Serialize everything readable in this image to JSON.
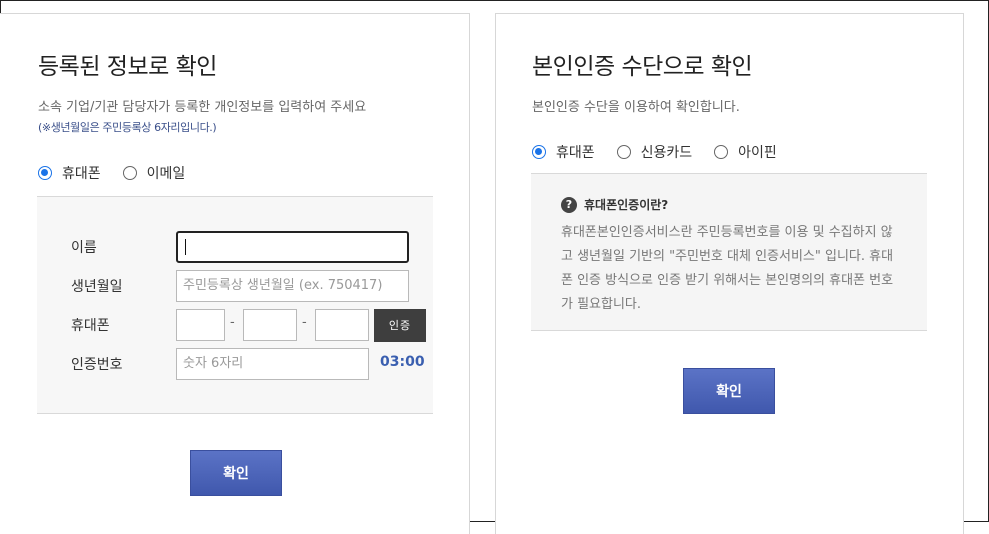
{
  "left": {
    "title": "등록된 정보로 확인",
    "desc": "소속 기업/기관 담당자가 등록한 개인정보를 입력하여 주세요",
    "note": "(※생년월일은 주민등록상 6자리입니다.)",
    "radios": [
      {
        "label": "휴대폰",
        "checked": true
      },
      {
        "label": "이메일",
        "checked": false
      }
    ],
    "form": {
      "name_label": "이름",
      "birth_label": "생년월일",
      "birth_placeholder": "주민등록상 생년월일 (ex. 750417)",
      "phone_label": "휴대폰",
      "phone_dash": "-",
      "cert_button": "인증",
      "code_label": "인증번호",
      "code_placeholder": "숫자 6자리",
      "timer": "03:00"
    },
    "confirm": "확인"
  },
  "right": {
    "title": "본인인증 수단으로 확인",
    "desc": "본인인증 수단을 이용하여 확인합니다.",
    "radios": [
      {
        "label": "휴대폰",
        "checked": true
      },
      {
        "label": "신용카드",
        "checked": false
      },
      {
        "label": "아이핀",
        "checked": false
      }
    ],
    "info": {
      "icon": "?",
      "heading": "휴대폰인증이란?",
      "text": "휴대폰본인인증서비스란 주민등록번호를 이용 및 수집하지 않고 생년월일 기반의 \"주민번호 대체 인증서비스\" 입니다. 휴대폰 인증 방식으로 인증 받기 위해서는 본인명의의 휴대폰 번호가 필요합니다."
    },
    "confirm": "확인"
  },
  "colors": {
    "accent": "#1a73e8",
    "button": "#4a62b8",
    "timer": "#3a5fb0"
  }
}
